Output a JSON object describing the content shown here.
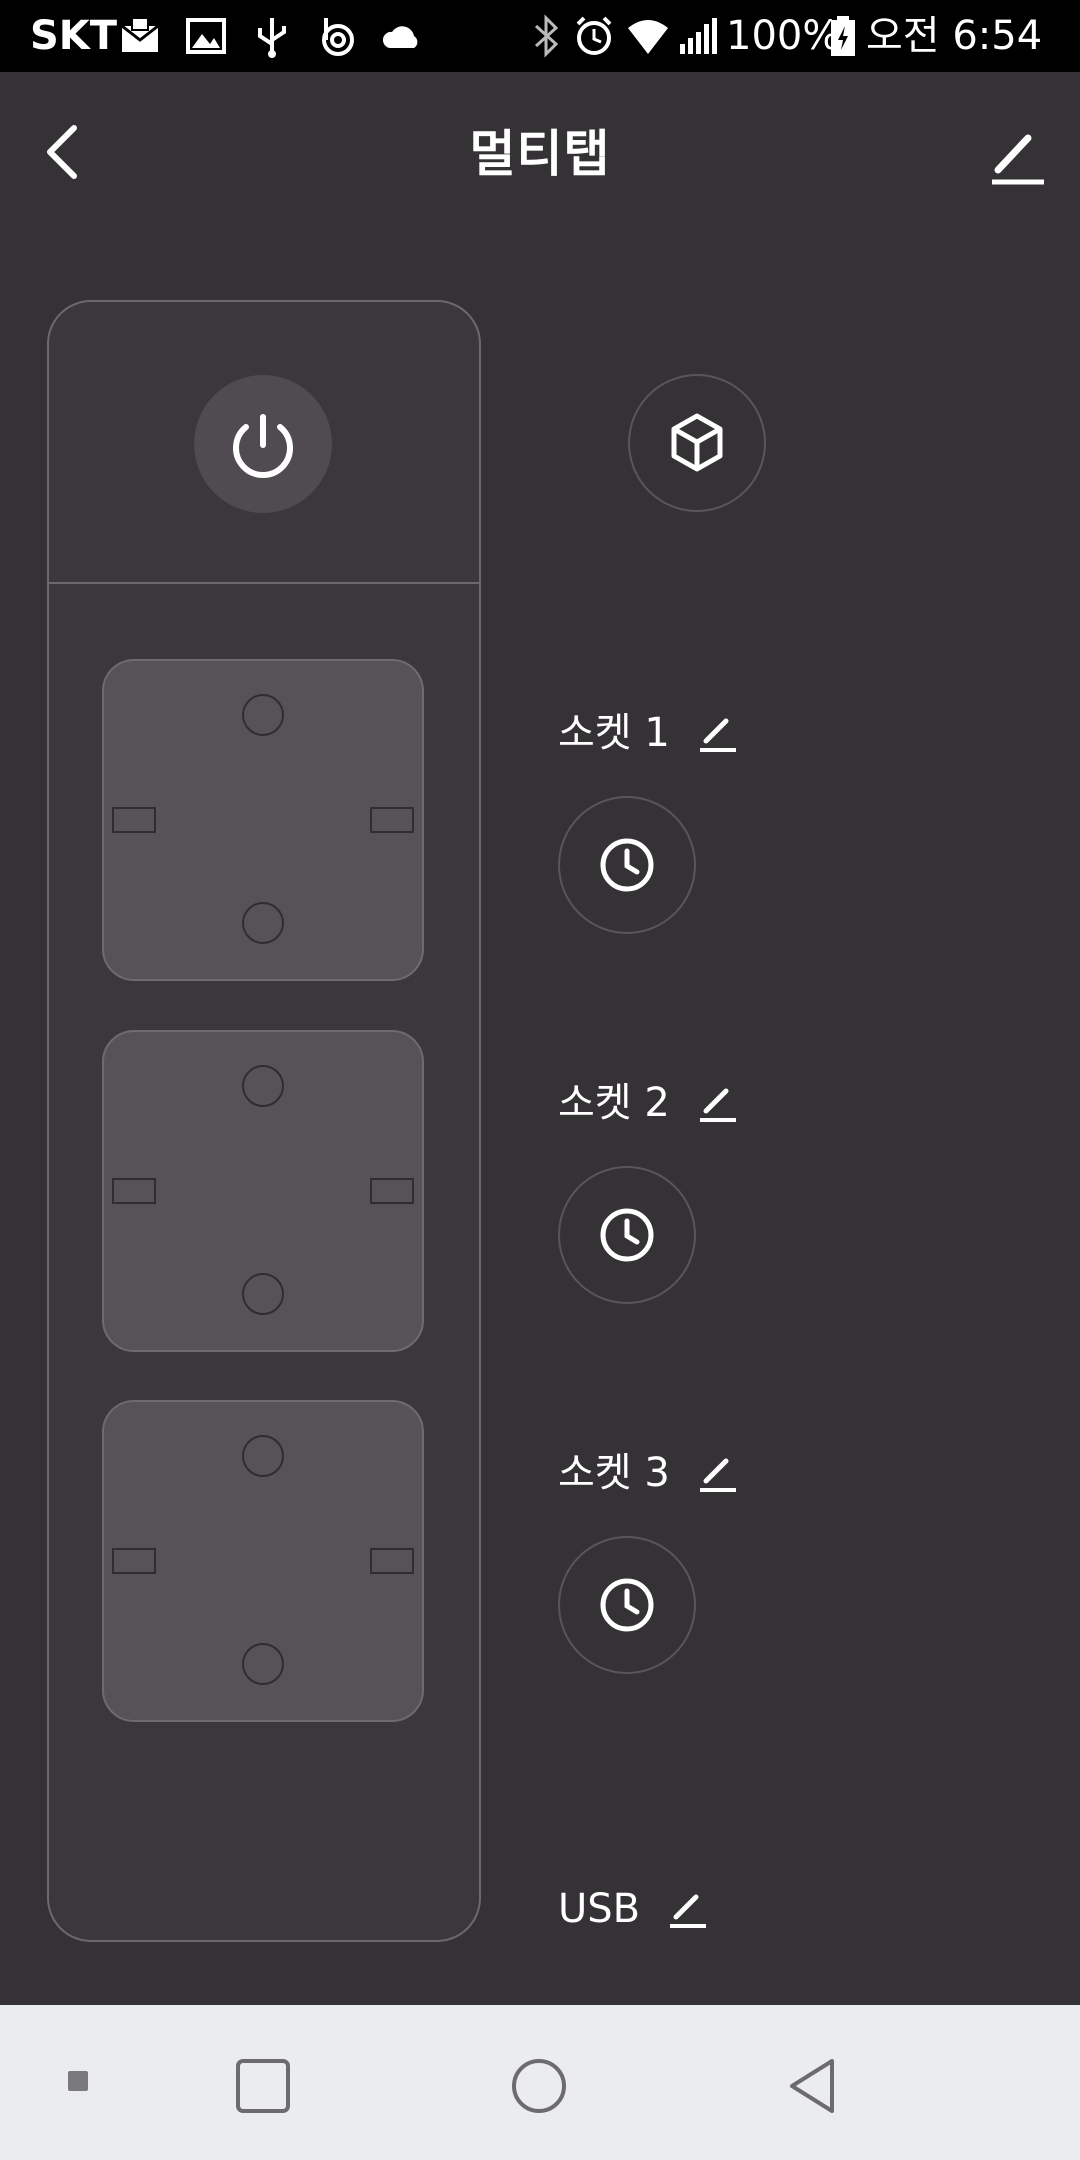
{
  "status_bar": {
    "carrier": "SKT",
    "battery": "100%",
    "time": "오전 6:54",
    "icons": [
      "naver-mail-icon",
      "gallery-icon",
      "usb-icon",
      "beats-icon",
      "cloud-icon",
      "bluetooth-icon",
      "alarm-icon",
      "wifi-icon",
      "signal-icon",
      "battery-icon"
    ]
  },
  "header": {
    "title": "멀티탭",
    "back_icon": "chevron-left-icon",
    "edit_icon": "pencil-icon"
  },
  "device": {
    "power_icon": "power-icon",
    "sockets_on_strip": 3,
    "mode_icon": "cube-icon"
  },
  "sockets": [
    {
      "label": "소켓 1",
      "edit_icon": "pencil-icon",
      "timer_icon": "clock-icon"
    },
    {
      "label": "소켓 2",
      "edit_icon": "pencil-icon",
      "timer_icon": "clock-icon"
    },
    {
      "label": "소켓 3",
      "edit_icon": "pencil-icon",
      "timer_icon": "clock-icon"
    }
  ],
  "usb": {
    "label": "USB",
    "edit_icon": "pencil-icon"
  },
  "nav_bar": {
    "items": [
      "recent-dot-icon",
      "recents-square-icon",
      "home-circle-icon",
      "back-triangle-icon"
    ]
  },
  "colors": {
    "background": "#353236",
    "strip": "#3b383c",
    "socket": "#555356",
    "status_bar": "#000000",
    "nav_bar": "#ebecf0",
    "text": "#ffffff"
  }
}
